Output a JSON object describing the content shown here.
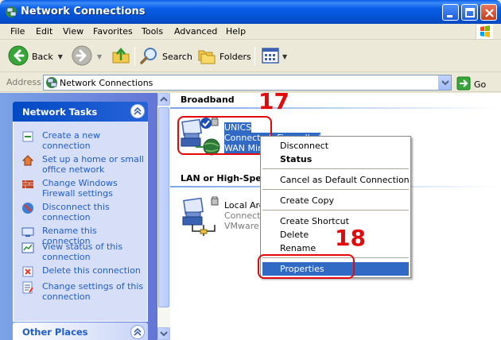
{
  "window": {
    "title": "Network Connections"
  },
  "menubar": {
    "items": [
      "File",
      "Edit",
      "View",
      "Favorites",
      "Tools",
      "Advanced",
      "Help"
    ]
  },
  "toolbar": {
    "back_label": "Back",
    "search_label": "Search",
    "folders_label": "Folders"
  },
  "addressbar": {
    "label": "Address",
    "value": "Network Connections",
    "go_label": "Go"
  },
  "taskpane": {
    "network_tasks_title": "Network Tasks",
    "tasks": [
      "Create a new connection",
      "Set up a home or small office network",
      "Change Windows Firewall settings",
      "Disconnect this connection",
      "Rename this connection",
      "View status of this connection",
      "Delete this connection",
      "Change settings of this connection"
    ],
    "other_places_title": "Other Places"
  },
  "content": {
    "broadband_header": "Broadband",
    "lan_header": "LAN or High-Speed",
    "unics": {
      "name": "UNICS",
      "status": "Connected, Firewalled",
      "device": "WAN Miniport"
    },
    "local_area": {
      "name": "Local Area",
      "status": "Connected",
      "device": "VMware Ac"
    }
  },
  "context_menu": {
    "items": [
      {
        "label": "Disconnect",
        "bold": false
      },
      {
        "label": "Status",
        "bold": true
      },
      {
        "label": "Cancel as Default Connection",
        "bold": false
      },
      {
        "label": "Create Copy",
        "bold": false
      },
      {
        "label": "Create Shortcut",
        "bold": false
      },
      {
        "label": "Delete",
        "bold": false
      },
      {
        "label": "Rename",
        "bold": false
      },
      {
        "label": "Properties",
        "bold": false,
        "highlighted": true
      }
    ]
  },
  "annotations": {
    "step_a": "17",
    "step_b": "18",
    "color": "#e4080a"
  },
  "colors": {
    "title_bar": "#0a5ee8",
    "task_link": "#215dc6",
    "selection": "#316ac5"
  }
}
